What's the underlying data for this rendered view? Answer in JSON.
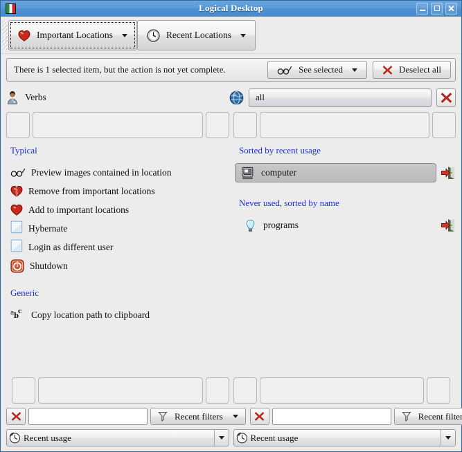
{
  "window": {
    "title": "Logical Desktop",
    "icon": "italian-flag-icon",
    "controls": {
      "minimize": "–",
      "maximize": "□",
      "close": "✕"
    }
  },
  "tabs": [
    {
      "label": "Important Locations",
      "icon": "heart-icon",
      "focused": true
    },
    {
      "label": "Recent Locations",
      "icon": "clock-icon",
      "focused": false
    }
  ],
  "status": {
    "message": "There is 1 selected item, but the action is not yet complete.",
    "see_selected_label": "See selected",
    "see_selected_icon": "glasses-icon",
    "deselect_all_label": "Deselect all",
    "deselect_all_icon": "red-x-icon"
  },
  "verbs": {
    "label": "Verbs",
    "icon": "person-icon",
    "scope_value": "all",
    "scope_icon": "globe-icon",
    "clear_icon": "red-x-icon"
  },
  "left_column": {
    "sections": [
      {
        "header": "Typical",
        "items": [
          {
            "label": "Preview images contained in location",
            "icon": "glasses-icon"
          },
          {
            "label": "Remove from important locations",
            "icon": "broken-heart-icon"
          },
          {
            "label": "Add to important locations",
            "icon": "heart-icon"
          },
          {
            "label": "Hybernate",
            "icon": "blank-square-icon"
          },
          {
            "label": "Login as different user",
            "icon": "blank-square-icon"
          },
          {
            "label": "Shutdown",
            "icon": "power-icon"
          }
        ]
      },
      {
        "header": "Generic",
        "items": [
          {
            "label": "Copy location path to clipboard",
            "icon": "abc-text-icon"
          }
        ]
      }
    ]
  },
  "right_column": {
    "sections": [
      {
        "header": "Sorted by recent usage",
        "items": [
          {
            "label": "computer",
            "icon": "monitor-icon",
            "selected": true,
            "go_icon": "enter-door-icon"
          }
        ]
      },
      {
        "header": "Never used, sorted by name",
        "items": [
          {
            "label": "programs",
            "icon": "lightbulb-icon",
            "selected": false,
            "go_icon": "enter-door-icon"
          }
        ]
      }
    ]
  },
  "bottom": {
    "left": {
      "clear_icon": "red-x-icon",
      "filter_value": "",
      "filter_placeholder": "",
      "recent_filters_label": "Recent filters",
      "recent_filters_icon": "funnel-icon",
      "sort_combo_value": "Recent usage",
      "sort_combo_icon": "recent-clock-icon"
    },
    "right": {
      "clear_icon": "red-x-icon",
      "filter_value": "",
      "filter_placeholder": "",
      "recent_filters_label": "Recent filters",
      "recent_filters_icon": "funnel-icon",
      "sort_combo_value": "Recent usage",
      "sort_combo_icon": "recent-clock-icon"
    }
  },
  "colors": {
    "titlebar": "#5b9bd9",
    "window_bg": "#ececec",
    "group_header": "#1a2ed2",
    "accent_red": "#c42b20",
    "selected_item": "#c2c0c3"
  }
}
